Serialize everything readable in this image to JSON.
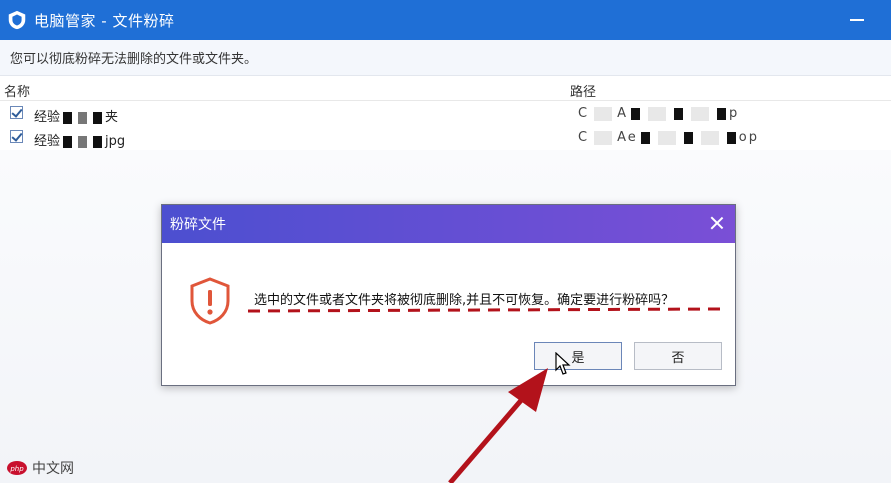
{
  "window": {
    "title": "电脑管家 - 文件粉碎",
    "info": "您可以彻底粉碎无法删除的文件或文件夹。"
  },
  "table": {
    "headers": [
      "名称",
      "路径"
    ],
    "rows": [
      {
        "name_prefix": "经验",
        "name_suffix": "夹",
        "path_start": "C",
        "path_mid": "A",
        "path_end": "p"
      },
      {
        "name_prefix": "经验",
        "name_suffix": "jpg",
        "path_start": "C",
        "path_mid": "Ae",
        "path_end": "op"
      }
    ]
  },
  "dialog": {
    "title": "粉碎文件",
    "message": "选中的文件或者文件夹将被彻底删除,并且不可恢复。确定要进行粉碎吗？",
    "yes_label": "是",
    "no_label": "否"
  },
  "watermark": {
    "text": "中文网"
  },
  "colors": {
    "titlebar": "#1f6fd6",
    "dialog_header_start": "#4c4fd0",
    "dialog_header_end": "#7a4fd6",
    "warning": "#e0563a",
    "annotation": "#b3121b"
  }
}
